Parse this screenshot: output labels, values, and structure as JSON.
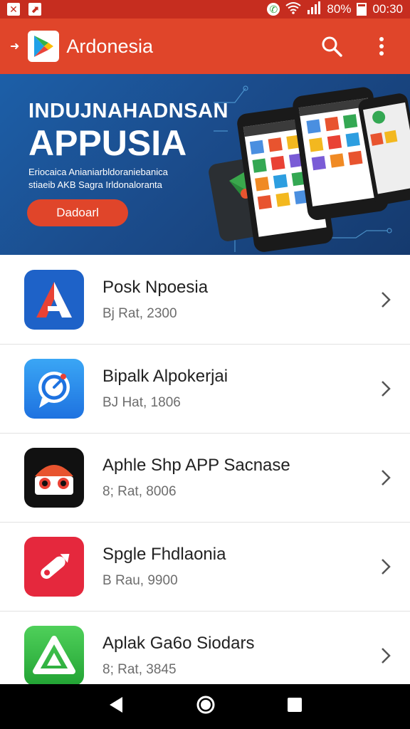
{
  "status_bar": {
    "left_icons": [
      "x-icon",
      "launch-icon"
    ],
    "battery_text": "80%",
    "time": "00:30"
  },
  "app_bar": {
    "title": "Ardonesia",
    "icons": [
      "play-store-logo-icon",
      "search-icon",
      "more-vert-icon"
    ]
  },
  "banner": {
    "line1": "INDUJNAHADNSAN",
    "line2": "APPUSIA",
    "sub1": "Eriocaica Anianiarbldoraniebanica",
    "sub2": "stiaeib AKB Sagra Irldonaloranta",
    "button_label": "Dadoarl"
  },
  "apps": [
    {
      "title": "Posk Npoesia",
      "meta": "Bj Rat, 2300",
      "icon": "letter-a-app-icon",
      "color": "#1e62c8"
    },
    {
      "title": "Bipalk Alpokerjai",
      "meta": "BJ Hat, 1806",
      "icon": "chat-bubble-app-icon",
      "color": "#2f8ef0"
    },
    {
      "title": "Aphle Shp APP Sacnase",
      "meta": "8; Rat, 8006",
      "icon": "eyes-app-icon",
      "color": "#111111"
    },
    {
      "title": "Spgle Fhdlaonia",
      "meta": "B Rau, 9900",
      "icon": "pencil-app-icon",
      "color": "#e5283d"
    },
    {
      "title": "Aplak Ga6o Siodars",
      "meta": "8; Rat, 3845",
      "icon": "triangle-app-icon",
      "color": "#2fba3f"
    }
  ],
  "nav_bar": {
    "icons": [
      "back-icon",
      "home-icon",
      "recents-icon"
    ]
  },
  "colors": {
    "status_bar": "#c62d1f",
    "app_bar": "#e0452a",
    "banner": "#1c5fa8",
    "accent": "#e0452a"
  }
}
